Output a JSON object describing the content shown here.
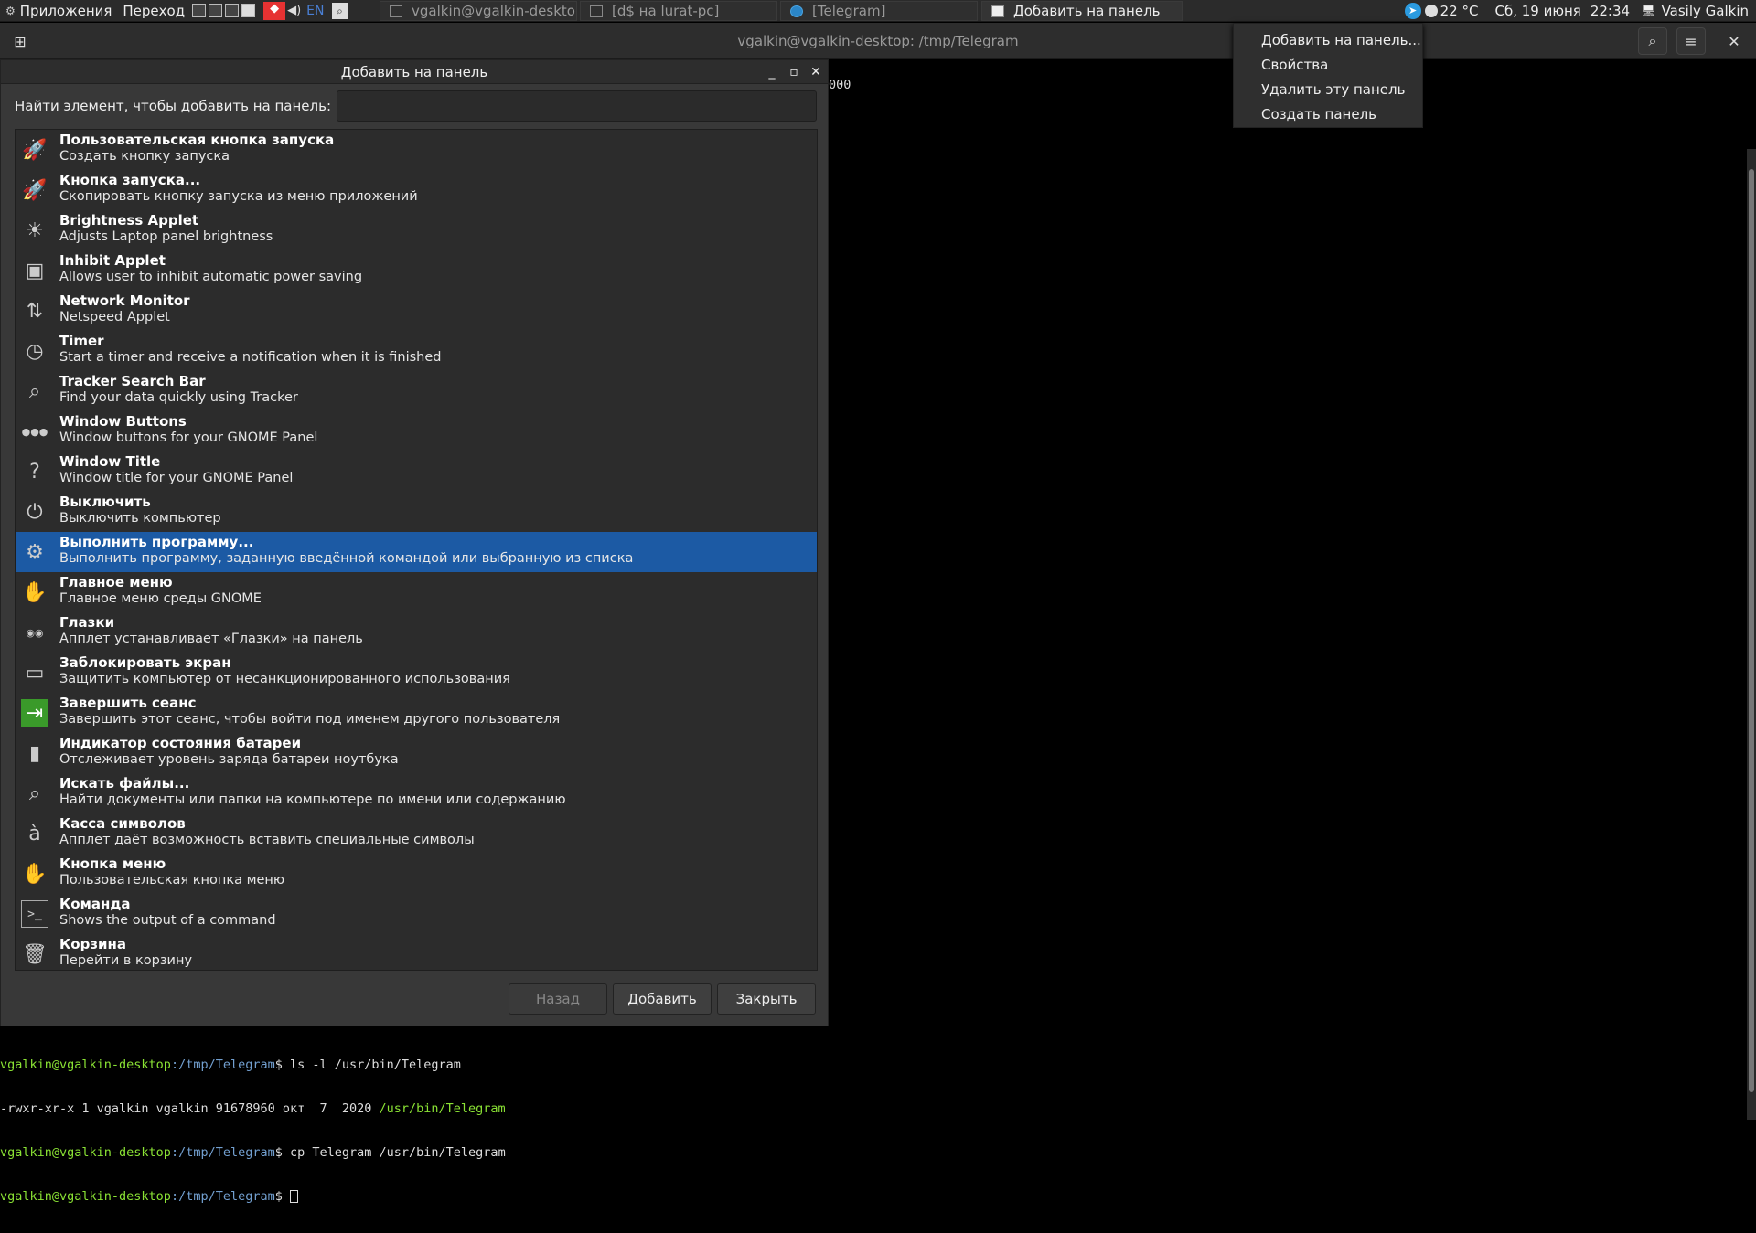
{
  "topbar": {
    "apps_label": "Приложения",
    "places_label": "Переход",
    "kbd_layout": "EN",
    "tasks": [
      {
        "label": "vgalkin@vgalkin-desktop..."
      },
      {
        "label": "[d$ на lurat-pc]"
      },
      {
        "label": "[Telegram]"
      },
      {
        "label": "Добавить на панель"
      }
    ],
    "weather": "22 °C",
    "date": "Сб, 19 июня",
    "time": "22:34",
    "user": "Vasily Galkin"
  },
  "terminal": {
    "title": "vgalkin@vgalkin-desktop: /tmp/Telegram",
    "partial_text": "000",
    "lines": [
      {
        "prompt_user": "vgalkin@vgalkin-desktop",
        "prompt_path": ":/tmp/Telegram",
        "cmd": "$ ls -l /usr/bin/Telegram"
      },
      {
        "output": "-rwxr-xr-x 1 vgalkin vgalkin 91678960 окт  7  2020 ",
        "output_path": "/usr/bin/Telegram"
      },
      {
        "prompt_user": "vgalkin@vgalkin-desktop",
        "prompt_path": ":/tmp/Telegram",
        "cmd": "$ cp Telegram /usr/bin/Telegram"
      },
      {
        "prompt_user": "vgalkin@vgalkin-desktop",
        "prompt_path": ":/tmp/Telegram",
        "cmd": "$ "
      }
    ]
  },
  "context_menu": {
    "items": [
      "Добавить на панель...",
      "Свойства",
      "Удалить эту панель",
      "Создать панель"
    ]
  },
  "dialog": {
    "title": "Добавить на панель",
    "search_label": "Найти элемент, чтобы добавить на панель:",
    "search_value": "",
    "selected_index": 10,
    "items": [
      {
        "title": "Пользовательская кнопка запуска",
        "desc": "Создать кнопку запуска",
        "icon": "launcher-icon"
      },
      {
        "title": "Кнопка запуска...",
        "desc": "Скопировать кнопку запуска из меню приложений",
        "icon": "launcher-icon"
      },
      {
        "title": "Brightness Applet",
        "desc": "Adjusts Laptop panel brightness",
        "icon": "brightness-icon"
      },
      {
        "title": "Inhibit Applet",
        "desc": "Allows user to inhibit automatic power saving",
        "icon": "inhibit-icon"
      },
      {
        "title": "Network Monitor",
        "desc": "Netspeed Applet",
        "icon": "network-icon"
      },
      {
        "title": "Timer",
        "desc": "Start a timer and receive a notification when it is finished",
        "icon": "timer-icon"
      },
      {
        "title": "Tracker Search Bar",
        "desc": "Find your data quickly using Tracker",
        "icon": "magnifier-icon"
      },
      {
        "title": "Window Buttons",
        "desc": "Window buttons for your GNOME Panel",
        "icon": "window-buttons-icon"
      },
      {
        "title": "Window Title",
        "desc": "Window title for your GNOME Panel",
        "icon": "window-title-icon"
      },
      {
        "title": "Выключить",
        "desc": "Выключить компьютер",
        "icon": "shutdown-icon"
      },
      {
        "title": "Выполнить программу...",
        "desc": "Выполнить программу, заданную введённой командой или выбранную из списка",
        "icon": "gears-icon"
      },
      {
        "title": "Главное меню",
        "desc": "Главное меню среды GNOME",
        "icon": "gnome-foot-icon"
      },
      {
        "title": "Глазки",
        "desc": "Апплет устанавливает «Глазки» на панель",
        "icon": "eyes-icon"
      },
      {
        "title": "Заблокировать экран",
        "desc": "Защитить компьютер от несанкционированного использования",
        "icon": "lock-screen-icon"
      },
      {
        "title": "Завершить сеанс",
        "desc": "Завершить этот сеанс, чтобы войти под именем другого пользователя",
        "icon": "exit-icon"
      },
      {
        "title": "Индикатор состояния батареи",
        "desc": "Отслеживает уровень заряда батареи ноутбука",
        "icon": "battery-icon"
      },
      {
        "title": "Искать файлы...",
        "desc": "Найти документы или папки на компьютере по имени или содержанию",
        "icon": "magnifier-icon"
      },
      {
        "title": "Касса символов",
        "desc": "Апплет даёт возможность вставить специальные символы",
        "icon": "charpick-icon"
      },
      {
        "title": "Кнопка меню",
        "desc": "Пользовательская кнопка меню",
        "icon": "gnome-foot-icon"
      },
      {
        "title": "Команда",
        "desc": "Shows the output of a command",
        "icon": "terminal-icon"
      },
      {
        "title": "Корзина",
        "desc": "Перейти в корзину",
        "icon": "trash-icon"
      }
    ],
    "buttons": {
      "back": "Назад",
      "add": "Добавить",
      "close": "Закрыть"
    }
  }
}
